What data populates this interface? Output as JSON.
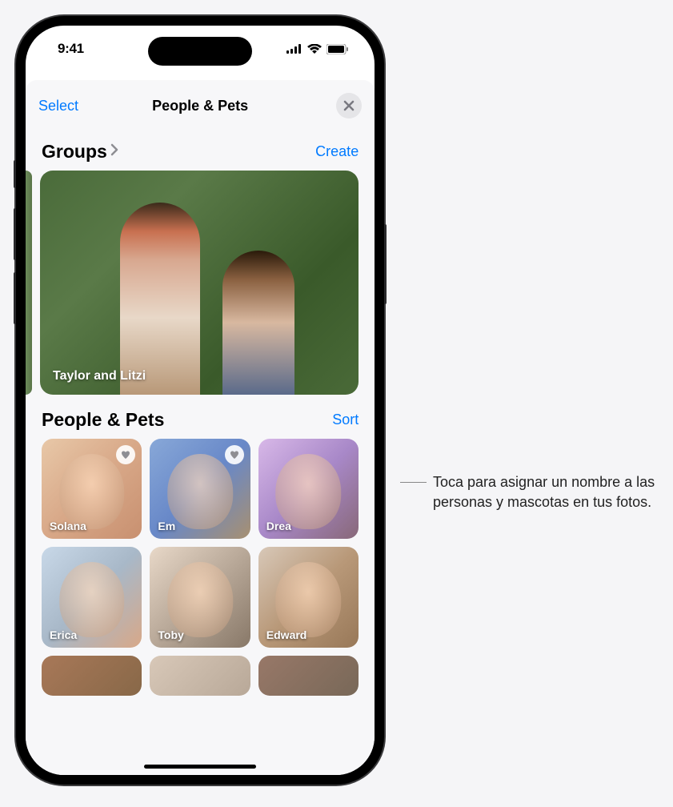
{
  "statusBar": {
    "time": "9:41"
  },
  "navBar": {
    "selectLabel": "Select",
    "title": "People & Pets"
  },
  "groups": {
    "title": "Groups",
    "createLabel": "Create",
    "card": {
      "label": "Taylor and Litzi"
    }
  },
  "peoplePets": {
    "title": "People & Pets",
    "sortLabel": "Sort",
    "items": [
      {
        "name": "Solana",
        "favorite": true
      },
      {
        "name": "Em",
        "favorite": true
      },
      {
        "name": "Drea",
        "favorite": false
      },
      {
        "name": "Erica",
        "favorite": false
      },
      {
        "name": "Toby",
        "favorite": false
      },
      {
        "name": "Edward",
        "favorite": false
      }
    ]
  },
  "callout": {
    "text": "Toca para asignar un nombre a las personas y mascotas en tus fotos."
  }
}
